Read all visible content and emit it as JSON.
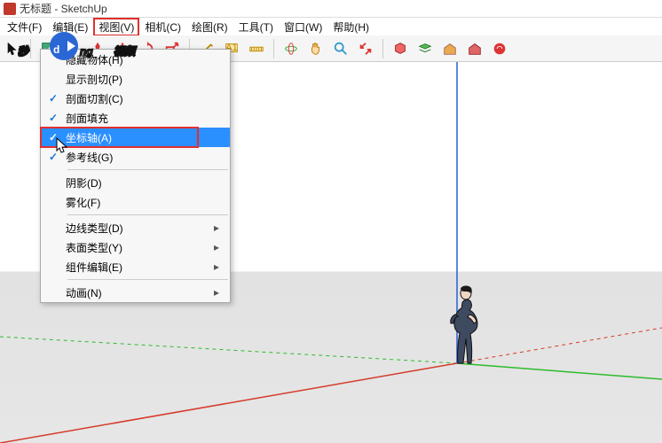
{
  "title": {
    "app_icon": "sketchup-icon",
    "text": "无标题 - SketchUp"
  },
  "menubar": {
    "file": "文件(F)",
    "edit": "编辑(E)",
    "view": "视图(V)",
    "camera": "相机(C)",
    "draw": "绘图(R)",
    "tools": "工具(T)",
    "window": "窗口(W)",
    "help": "帮助(H)"
  },
  "dropdown": {
    "hiddenGeometry": "隐藏物体(H)",
    "showSectionCuts": "显示剖切(P)",
    "sectionPlanes": "剖面切割(C)",
    "sectionFill": "剖面填充",
    "axes": "坐标轴(A)",
    "guides": "参考线(G)",
    "shadows": "阴影(D)",
    "fog": "雾化(F)",
    "edgeStyle": "边线类型(D)",
    "faceStyle": "表面类型(Y)",
    "componentEdit": "组件编辑(E)",
    "animation": "动画(N)",
    "submenu_arrow": "▸"
  },
  "watermark": "秒dong视频",
  "icons": {
    "select": "select",
    "eraser": "eraser",
    "line": "line",
    "arc": "arc",
    "rect": "rect",
    "circle": "circle",
    "poly": "poly",
    "push": "push",
    "move": "move",
    "rotate": "rotate",
    "offset": "offset",
    "tape": "tape",
    "text": "text",
    "paint": "paint",
    "orbit": "orbit",
    "pan": "pan",
    "zoom": "zoom",
    "zoomext": "zoomext",
    "prev": "prev",
    "comp": "comp",
    "model": "model",
    "wh": "wh",
    "ext": "ext"
  }
}
